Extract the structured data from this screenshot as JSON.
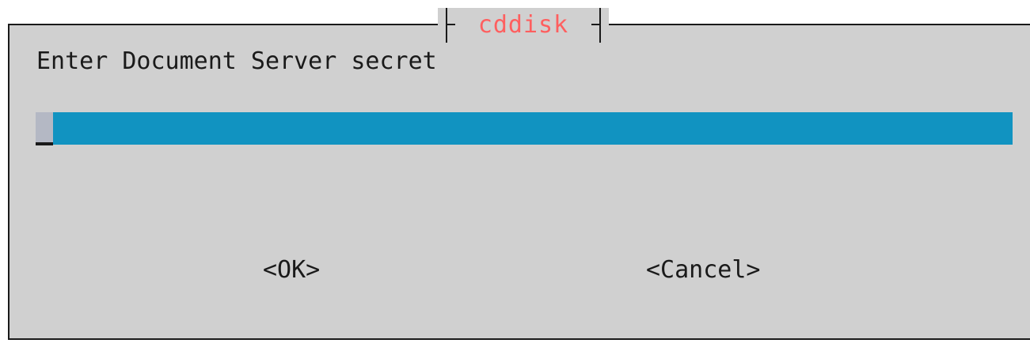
{
  "dialog": {
    "title": "cddisk",
    "prompt": "Enter Document Server secret",
    "input_value": "",
    "buttons": {
      "ok_label": "<OK>",
      "cancel_label": "<Cancel>"
    }
  },
  "colors": {
    "dialog_background": "#d0d0d0",
    "title_color": "#ff5f5f",
    "input_background": "#1193c1",
    "text_color": "#1a1a1a"
  }
}
